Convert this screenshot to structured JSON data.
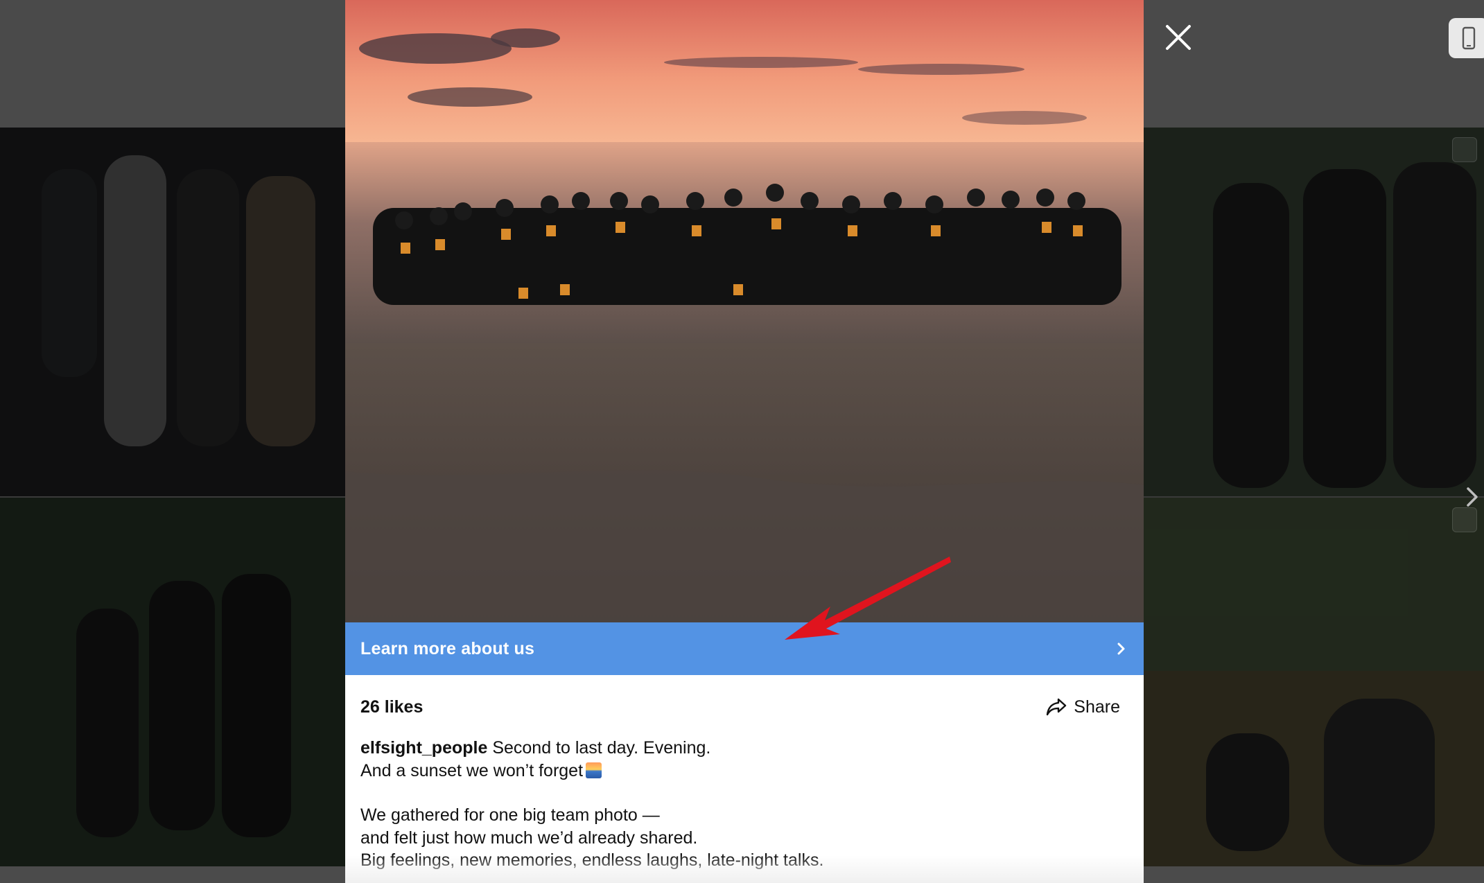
{
  "modal": {
    "cta_label": "Learn more about us",
    "likes": "26 likes",
    "share_label": "Share",
    "caption": {
      "username": "elfsight_people",
      "line1_rest": " Second to last day. Evening.",
      "line2": "And a sunset we won’t forget",
      "line3": "We gathered for one big team photo —",
      "line4": "and felt just how much we’d already shared.",
      "line5": "Big feelings, new memories, endless laughs, late-night talks."
    }
  },
  "icons": {
    "close": "close-icon",
    "device": "mobile-device-icon",
    "next": "chevron-right-icon",
    "share": "share-arrow-icon",
    "cta_chevron": "chevron-right-icon",
    "annotation": "red-arrow-annotation"
  },
  "colors": {
    "cta_background": "#5393e4",
    "annotation_arrow": "#e0141e",
    "backdrop": "#3a3a3a"
  }
}
